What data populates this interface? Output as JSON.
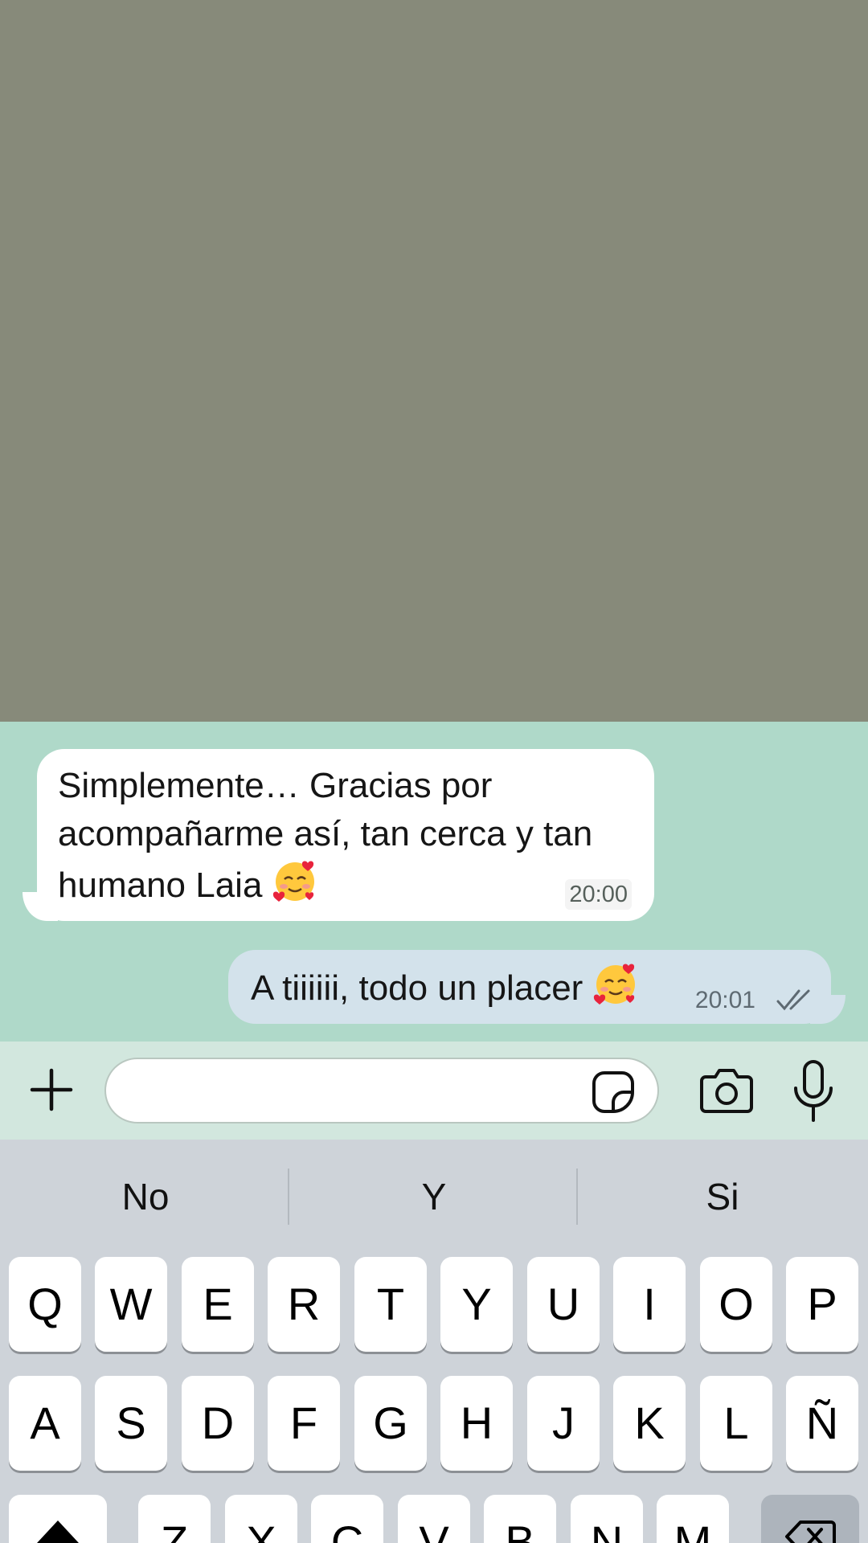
{
  "chat": {
    "messages": [
      {
        "direction": "incoming",
        "text": "Simplemente… Gracias por acompañarme así, tan cerca y tan humano Laia",
        "emoji": "smiling-face-with-hearts",
        "time": "20:00"
      },
      {
        "direction": "outgoing",
        "text": "A tiiiiii, todo un placer",
        "emoji": "smiling-face-with-hearts",
        "time": "20:01",
        "status": "delivered"
      }
    ]
  },
  "composer": {
    "text_value": "",
    "icons": [
      "plus-icon",
      "sticker-icon",
      "camera-icon",
      "microphone-icon"
    ]
  },
  "keyboard": {
    "suggestions": [
      "No",
      "Y",
      "Si"
    ],
    "row1": [
      "Q",
      "W",
      "E",
      "R",
      "T",
      "Y",
      "U",
      "I",
      "O",
      "P"
    ],
    "row2": [
      "A",
      "S",
      "D",
      "F",
      "G",
      "H",
      "J",
      "K",
      "L",
      "Ñ"
    ],
    "row3": [
      "Z",
      "X",
      "C",
      "V",
      "B",
      "N",
      "M"
    ],
    "special_keys": [
      "shift-icon",
      "backspace-icon"
    ]
  },
  "colors": {
    "overlay": "#878a7a",
    "chat_background": "#afd9c9",
    "incoming_bubble": "#ffffff",
    "outgoing_bubble": "#d3e2eb",
    "input_bar": "#d2e7de",
    "keyboard": "#ced3d9"
  }
}
